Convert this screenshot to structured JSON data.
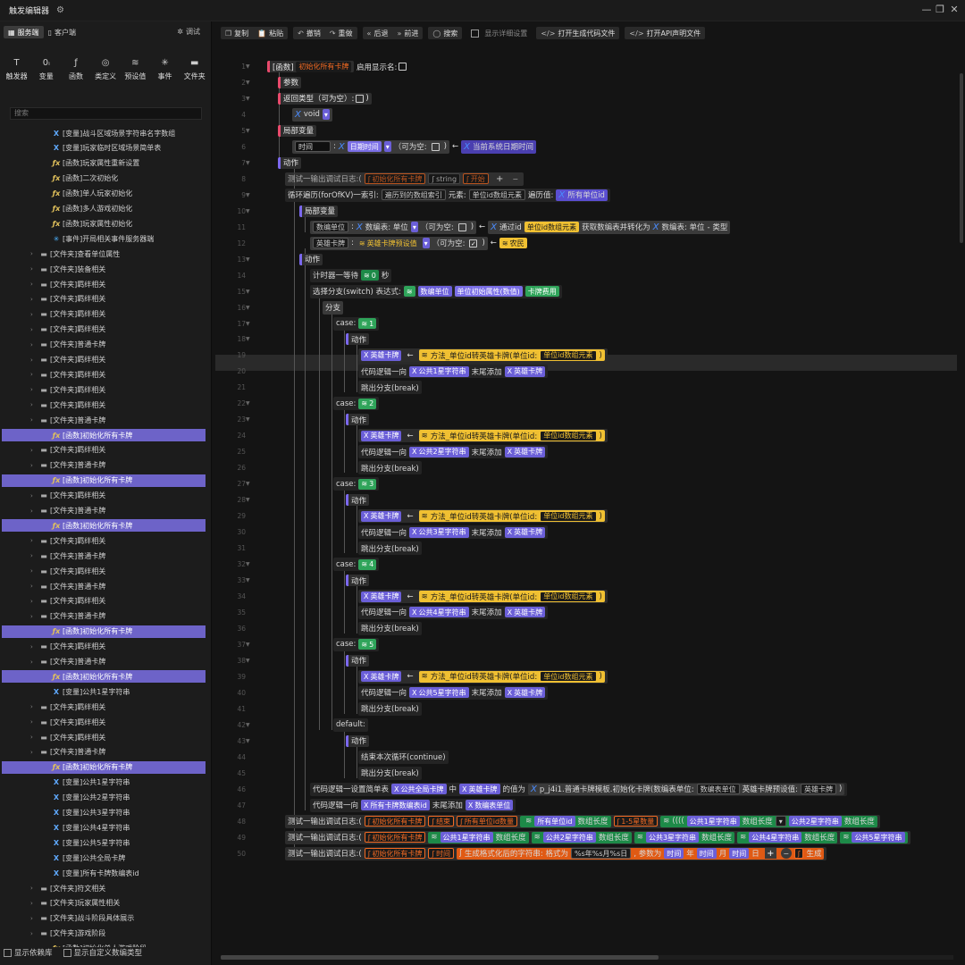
{
  "app": {
    "title": "触发编辑器",
    "gear_icon": "gear-icon"
  },
  "sidebar": {
    "tabs": [
      {
        "label": "服务端",
        "icon": "server-icon"
      },
      {
        "label": "客户端",
        "icon": "client-icon"
      }
    ],
    "debug_label": "调试",
    "categories": [
      {
        "label": "触发器",
        "icon": "trigger-icon"
      },
      {
        "label": "变量",
        "icon": "variable-icon"
      },
      {
        "label": "函数",
        "icon": "function-icon"
      },
      {
        "label": "类定义",
        "icon": "class-icon"
      },
      {
        "label": "预设值",
        "icon": "preset-icon"
      },
      {
        "label": "事件",
        "icon": "event-icon"
      },
      {
        "label": "文件夹",
        "icon": "folder-icon"
      }
    ],
    "search_placeholder": "搜索",
    "tree": [
      {
        "t": "[变量]战斗区域场景字符串名字数组",
        "k": "var",
        "i": 2
      },
      {
        "t": "[变量]玩家临时区域场景简单表",
        "k": "var",
        "i": 2
      },
      {
        "t": "[函数]玩家属性重新设置",
        "k": "fn",
        "i": 2
      },
      {
        "t": "[函数]二次初始化",
        "k": "fn",
        "i": 2
      },
      {
        "t": "[函数]单人玩家初始化",
        "k": "fn",
        "i": 2
      },
      {
        "t": "[函数]多人游戏初始化",
        "k": "fn",
        "i": 2
      },
      {
        "t": "[函数]玩家属性初始化",
        "k": "fn",
        "i": 2
      },
      {
        "t": "[事件]开局相关事件服务器端",
        "k": "ev",
        "i": 2
      },
      {
        "t": "[文件夹]查看单位属性",
        "k": "folder",
        "i": 1
      },
      {
        "t": "[文件夹]装备相关",
        "k": "folder",
        "i": 1
      },
      {
        "t": "[文件夹]羁绊相关",
        "k": "folder",
        "i": 1
      },
      {
        "t": "[文件夹]羁绊相关",
        "k": "folder",
        "i": 1
      },
      {
        "t": "[文件夹]羁绊相关",
        "k": "folder",
        "i": 1
      },
      {
        "t": "[文件夹]羁绊相关",
        "k": "folder",
        "i": 1
      },
      {
        "t": "[文件夹]普通卡牌",
        "k": "folder",
        "i": 1
      },
      {
        "t": "[文件夹]羁绊相关",
        "k": "folder",
        "i": 1
      },
      {
        "t": "[文件夹]羁绊相关",
        "k": "folder",
        "i": 1
      },
      {
        "t": "[文件夹]羁绊相关",
        "k": "folder",
        "i": 1
      },
      {
        "t": "[文件夹]羁绊相关",
        "k": "folder",
        "i": 1
      },
      {
        "t": "[文件夹]普通卡牌",
        "k": "folder",
        "i": 1
      },
      {
        "t": "[函数]初始化所有卡牌",
        "k": "fn",
        "i": 2,
        "hl": true
      },
      {
        "t": "[文件夹]羁绊相关",
        "k": "folder",
        "i": 1
      },
      {
        "t": "[文件夹]普通卡牌",
        "k": "folder",
        "i": 1
      },
      {
        "t": "[函数]初始化所有卡牌",
        "k": "fn",
        "i": 2,
        "hl": true
      },
      {
        "t": "[文件夹]羁绊相关",
        "k": "folder",
        "i": 1
      },
      {
        "t": "[文件夹]普通卡牌",
        "k": "folder",
        "i": 1
      },
      {
        "t": "[函数]初始化所有卡牌",
        "k": "fn",
        "i": 2,
        "hl": true
      },
      {
        "t": "[文件夹]羁绊相关",
        "k": "folder",
        "i": 1
      },
      {
        "t": "[文件夹]普通卡牌",
        "k": "folder",
        "i": 1
      },
      {
        "t": "[文件夹]羁绊相关",
        "k": "folder",
        "i": 1
      },
      {
        "t": "[文件夹]普通卡牌",
        "k": "folder",
        "i": 1
      },
      {
        "t": "[文件夹]羁绊相关",
        "k": "folder",
        "i": 1
      },
      {
        "t": "[文件夹]普通卡牌",
        "k": "folder",
        "i": 1
      },
      {
        "t": "[函数]初始化所有卡牌",
        "k": "fn",
        "i": 2,
        "hl": true
      },
      {
        "t": "[文件夹]羁绊相关",
        "k": "folder",
        "i": 1
      },
      {
        "t": "[文件夹]普通卡牌",
        "k": "folder",
        "i": 1
      },
      {
        "t": "[函数]初始化所有卡牌",
        "k": "fn",
        "i": 2,
        "hl": true
      },
      {
        "t": "[变量]公共1星字符串",
        "k": "var",
        "i": 2
      },
      {
        "t": "[文件夹]羁绊相关",
        "k": "folder",
        "i": 1
      },
      {
        "t": "[文件夹]羁绊相关",
        "k": "folder",
        "i": 1
      },
      {
        "t": "[文件夹]羁绊相关",
        "k": "folder",
        "i": 1
      },
      {
        "t": "[文件夹]普通卡牌",
        "k": "folder",
        "i": 1
      },
      {
        "t": "[函数]初始化所有卡牌",
        "k": "fn",
        "i": 2,
        "hl": true
      },
      {
        "t": "[变量]公共1星字符串",
        "k": "var",
        "i": 2
      },
      {
        "t": "[变量]公共2星字符串",
        "k": "var",
        "i": 2
      },
      {
        "t": "[变量]公共3星字符串",
        "k": "var",
        "i": 2
      },
      {
        "t": "[变量]公共4星字符串",
        "k": "var",
        "i": 2
      },
      {
        "t": "[变量]公共5星字符串",
        "k": "var",
        "i": 2
      },
      {
        "t": "[变量]公共全局卡牌",
        "k": "var",
        "i": 2
      },
      {
        "t": "[变量]所有卡牌数编表id",
        "k": "var",
        "i": 2
      },
      {
        "t": "[文件夹]符文相关",
        "k": "folder",
        "i": 1
      },
      {
        "t": "[文件夹]玩家属性相关",
        "k": "folder",
        "i": 1
      },
      {
        "t": "[文件夹]战斗阶段具体展示",
        "k": "folder",
        "i": 1
      },
      {
        "t": "[文件夹]游戏阶段",
        "k": "folder",
        "i": 1
      },
      {
        "t": "[函数]初始化单人游戏阶段",
        "k": "fn",
        "i": 2
      }
    ],
    "footer": {
      "show_deps": "显示依赖库",
      "show_custom": "显示自定义数编类型"
    }
  },
  "toolbar": {
    "copy": "复制",
    "paste": "粘贴",
    "undo": "撤销",
    "redo": "重做",
    "back": "后退",
    "forward": "前进",
    "search": "搜索",
    "show_details": "显示详细设置",
    "open_code": "打开生成代码文件",
    "open_api": "打开API声明文件"
  },
  "code": {
    "fn_tag": "[函数]",
    "fn_name": "初始化所有卡牌",
    "show_name": "启用显示名:",
    "params": "参数",
    "return_type": "返回类型（可为空）:",
    "void": "void",
    "local_vars": "局部变量",
    "time_var": "时间",
    "date_time": "日期时间",
    "nullable": "（可为空:",
    "now": "当前系统日期时间",
    "actions": "动作",
    "debug_log": "测试一输出调试日志:(",
    "string_kw": "string",
    "begin": "开始",
    "loop": "循环遍历(forOfKV)一索引:",
    "loop_idx": "遍历到的数组索引",
    "elem": "元素:",
    "unit_elem": "单位id数组元素",
    "loop_val": "遍历值:",
    "all_units": "所有单位id",
    "data_unit": "数编单位",
    "data_table_unit": "数编表: 单位",
    "via_id": "通过id",
    "unit_id_elem": "单位id数组元素",
    "get_convert": "获取数编表并转化为",
    "type_suffix": "- 类型",
    "hero_card": "英雄卡牌",
    "hero_preset": "英雄卡牌预设值",
    "farmer": "农民",
    "timer_wait": "计时器一等待",
    "zero": "0",
    "sec": "秒",
    "switch": "选择分支(switch) 表达式:",
    "unit_init_attr": "单位初始属性(数值)",
    "card_cost": "卡牌费用",
    "branch": "分支",
    "case": "case:",
    "action": "动作",
    "method": "方法_单位id转英雄卡牌(单位id:",
    "array_append_pre": "代码逻辑一向",
    "star1": "公共1星字符串",
    "star2": "公共2星字符串",
    "star3": "公共3星字符串",
    "star4": "公共4星字符串",
    "star5": "公共5星字符串",
    "append_tail": "末尾添加",
    "break": "跳出分支(break)",
    "default": "default:",
    "continue": "结束本次循环(continue)",
    "n1": "1",
    "n2": "2",
    "n3": "3",
    "n4": "4",
    "n5": "5",
    "set_table": "代码逻辑一设置简单表",
    "global_cards": "公共全局卡牌",
    "in": "中",
    "value_is": "的值为",
    "p_tpl": "p_j4i1.普通卡牌模板.初始化卡牌(数编表单位:",
    "hero_preset2": "英雄卡牌预设值:",
    "all_card_ids": "所有卡牌数编表id",
    "data_table_id": "数编表单位",
    "end": "结束",
    "unit_arr_count": "所有单位id数量",
    "arr_len": "数组长度",
    "count_1_5": "1-5星数量",
    "time": "时间",
    "gen_fmt": "生成格式化后的字符串: 格式为",
    "fmt": "%s年%s月%s日",
    "params_is": ", 参数为",
    "year": "年",
    "month": "月",
    "day": "日",
    "gen_trunc": "生成"
  },
  "line_numbers": [
    "1",
    "2",
    "3",
    "4",
    "5",
    "6",
    "7",
    "8",
    "9",
    "10",
    "11",
    "12",
    "13",
    "14",
    "15",
    "16",
    "17",
    "18",
    "19",
    "20",
    "21",
    "22",
    "23",
    "24",
    "25",
    "26",
    "27",
    "28",
    "29",
    "30",
    "31",
    "32",
    "33",
    "34",
    "35",
    "36",
    "37",
    "38",
    "39",
    "40",
    "41",
    "42",
    "43",
    "44",
    "45",
    "46",
    "47",
    "48",
    "49",
    "50"
  ]
}
